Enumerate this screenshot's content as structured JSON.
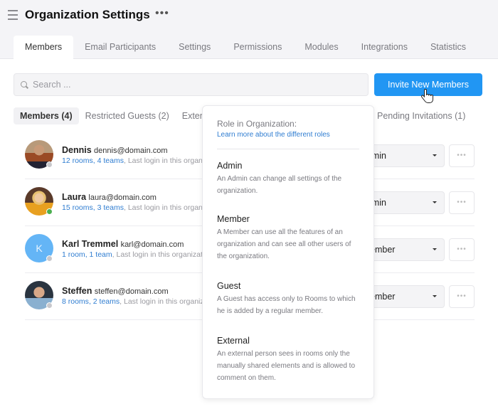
{
  "header": {
    "title": "Organization Settings",
    "more_label": "•••"
  },
  "tabs": [
    {
      "label": "Members",
      "active": true
    },
    {
      "label": "Email Participants"
    },
    {
      "label": "Settings"
    },
    {
      "label": "Permissions"
    },
    {
      "label": "Modules"
    },
    {
      "label": "Integrations"
    },
    {
      "label": "Statistics"
    }
  ],
  "search": {
    "placeholder": "Search ...",
    "value": ""
  },
  "invite_button": {
    "label": "Invite New Members",
    "color": "#2196f3"
  },
  "subtabs": [
    {
      "label": "Members (4)",
      "active": true
    },
    {
      "label": "Restricted Guests (2)"
    },
    {
      "label": "Externa"
    }
  ],
  "pending": {
    "label": "Pending Invitations (1)"
  },
  "members": [
    {
      "name": "Dennis",
      "email": "dennis@domain.com",
      "rooms": "12 rooms",
      "teams": "4 teams",
      "last_login": ", Last login in this organization",
      "role": "Admin",
      "role_visible": "lmin",
      "status": "offline",
      "avatar": "photo"
    },
    {
      "name": "Laura",
      "email": "laura@domain.com",
      "rooms": "15 rooms",
      "teams": "3 teams",
      "last_login": ", Last login in this organization",
      "role": "Admin",
      "role_visible": "lmin",
      "status": "online",
      "avatar": "photo"
    },
    {
      "name": "Karl Tremmel",
      "email": "karl@domain.com",
      "rooms": "1 room",
      "teams": "1 team",
      "last_login": ", Last login in this organization",
      "role": "Member",
      "role_visible": "ember",
      "status": "offline",
      "avatar": "K"
    },
    {
      "name": "Steffen",
      "email": "steffen@domain.com",
      "rooms": "8 rooms",
      "teams": "2 teams",
      "last_login": ", Last login in this organization",
      "role": "Member",
      "role_visible": "ember",
      "status": "offline",
      "avatar": "photo"
    }
  ],
  "more_button_label": "•••",
  "popover": {
    "heading": "Role in Organization:",
    "link": "Learn more about the different roles",
    "roles": [
      {
        "title": "Admin",
        "description": "An Admin can change all settings of the organization."
      },
      {
        "title": "Member",
        "description": "A Member can use all the features of an organization and can see all other users of the organization."
      },
      {
        "title": "Guest",
        "description": "A Guest has access only to Rooms to which he is added by a regular member."
      },
      {
        "title": "External",
        "description": "An external person sees in rooms only the manually shared elements and is allowed to comment on them."
      }
    ]
  }
}
